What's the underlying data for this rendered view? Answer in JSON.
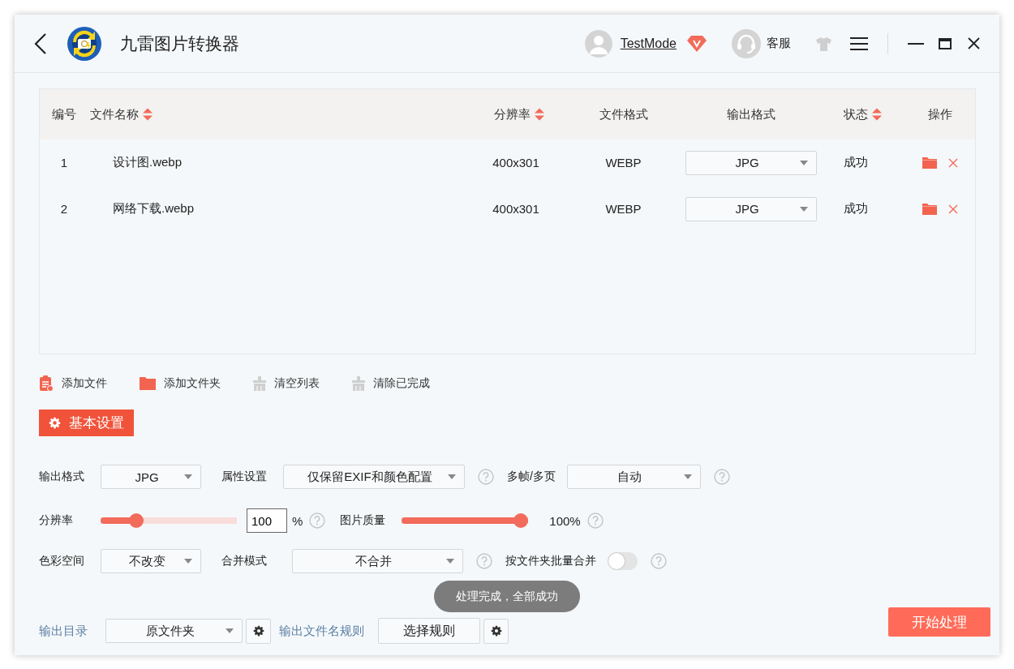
{
  "window": {
    "title": "九雷图片转换器"
  },
  "header": {
    "user": {
      "name": "TestMode"
    },
    "support": {
      "label": "客服"
    }
  },
  "table": {
    "columns": [
      {
        "label": "编号",
        "sortable": false
      },
      {
        "label": "文件名称",
        "sortable": true
      },
      {
        "label": "分辨率",
        "sortable": true
      },
      {
        "label": "文件格式",
        "sortable": false
      },
      {
        "label": "输出格式",
        "sortable": false
      },
      {
        "label": "状态",
        "sortable": true
      },
      {
        "label": "操作",
        "sortable": false
      }
    ],
    "rows": [
      {
        "index": "1",
        "name": "设计图.webp",
        "resolution": "400x301",
        "format": "WEBP",
        "output_format": "JPG",
        "status": "成功"
      },
      {
        "index": "2",
        "name": "网络下载.webp",
        "resolution": "400x301",
        "format": "WEBP",
        "output_format": "JPG",
        "status": "成功"
      }
    ]
  },
  "toolbar": [
    {
      "kind": "add-file",
      "label": "添加文件"
    },
    {
      "kind": "add-folder",
      "label": "添加文件夹"
    },
    {
      "kind": "clear",
      "label": "清空列表"
    },
    {
      "kind": "clear",
      "label": "清除已完成"
    }
  ],
  "settings_tab": {
    "label": "基本设置"
  },
  "settings": {
    "output_format": {
      "label": "输出格式",
      "value": "JPG"
    },
    "attributes": {
      "label": "属性设置",
      "value": "仅保留EXIF和颜色配置"
    },
    "frames": {
      "label": "多帧/多页",
      "value": "自动"
    },
    "resolution": {
      "label": "分辨率",
      "level": 0.23,
      "value": "100",
      "unit": "%"
    },
    "quality": {
      "label": "图片质量",
      "level": 1.0,
      "reading": "100%"
    },
    "color_space": {
      "label": "色彩空间",
      "value": "不改变"
    },
    "merge_mode": {
      "label": "合并模式",
      "value": "不合并"
    },
    "folder_merge": {
      "label": "按文件夹批量合并",
      "on": false
    }
  },
  "footer": {
    "output_dir": {
      "label": "输出目录",
      "value": "原文件夹"
    },
    "filename_rule": {
      "label": "输出文件名规则",
      "button": "选择规则"
    },
    "toast": "处理完成，全部成功",
    "start_button": "开始处理"
  }
}
